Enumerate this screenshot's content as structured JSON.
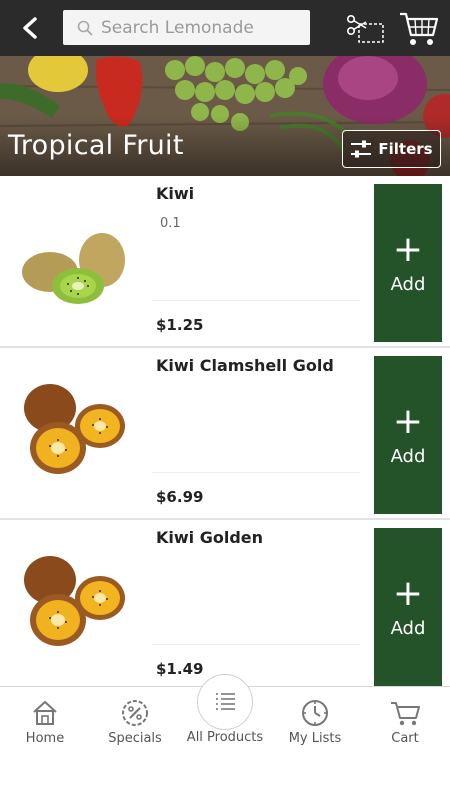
{
  "header": {
    "search_placeholder": "Search Lemonade"
  },
  "banner": {
    "title": "Tropical Fruit",
    "filters_label": "Filters"
  },
  "products": [
    {
      "name": "Kiwi",
      "size": "0.1",
      "price": "$1.25",
      "add_label": "Add",
      "image": "green-kiwi"
    },
    {
      "name": "Kiwi Clamshell Gold",
      "size": "",
      "price": "$6.99",
      "add_label": "Add",
      "image": "golden-kiwi"
    },
    {
      "name": "Kiwi Golden",
      "size": "",
      "price": "$1.49",
      "add_label": "Add",
      "image": "golden-kiwi"
    }
  ],
  "nav": {
    "home": "Home",
    "specials": "Specials",
    "all_products": "All Products",
    "my_lists": "My Lists",
    "cart": "Cart"
  },
  "colors": {
    "topbar": "#2b2b2b",
    "add_button": "#24532a",
    "nav_icon": "#777777"
  },
  "icons": [
    "back-arrow-icon",
    "search-icon",
    "coupon-scissors-icon",
    "cart-icon",
    "filters-sliders-icon",
    "home-icon",
    "specials-percent-icon",
    "list-icon",
    "clock-icon"
  ]
}
